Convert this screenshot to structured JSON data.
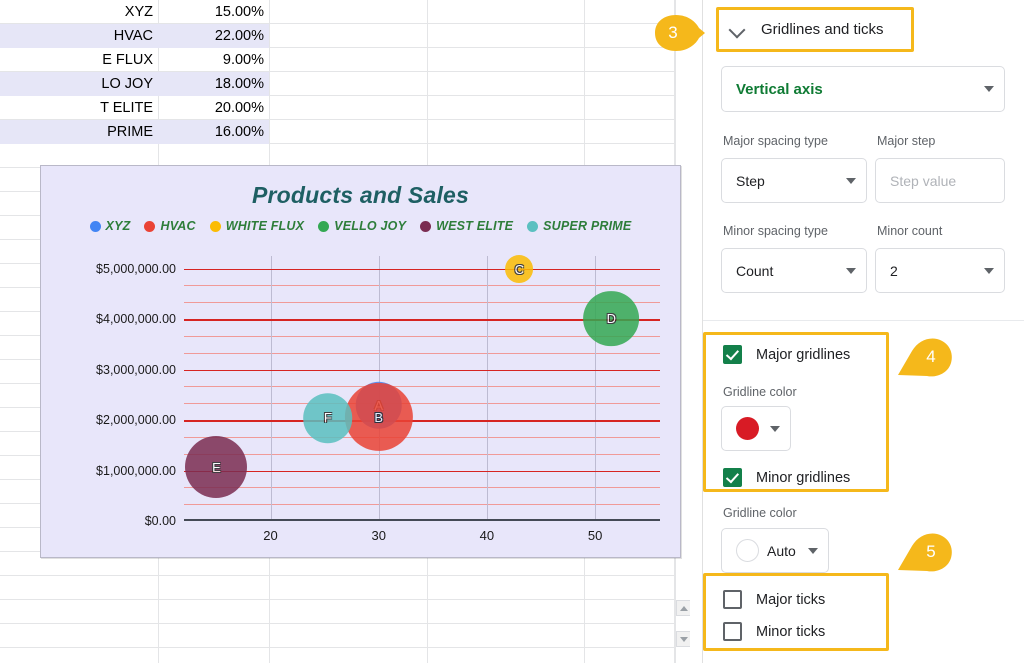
{
  "spreadsheet": {
    "rows": [
      {
        "name": "XYZ",
        "value": "15.00%",
        "shaded": false
      },
      {
        "name": "HVAC",
        "value": "22.00%",
        "shaded": true
      },
      {
        "name": "E FLUX",
        "value": "9.00%",
        "shaded": false
      },
      {
        "name": "LO JOY",
        "value": "18.00%",
        "shaded": true
      },
      {
        "name": "T ELITE",
        "value": "20.00%",
        "shaded": false
      },
      {
        "name": "PRIME",
        "value": "16.00%",
        "shaded": true
      }
    ],
    "scrollbar": {
      "up_icon": "scroll-up-arrow",
      "down_icon": "scroll-down-arrow"
    }
  },
  "chart_data": {
    "type": "scatter",
    "title": "Products and Sales",
    "xlabel": "",
    "ylabel": "",
    "xlim": [
      12,
      56
    ],
    "ylim": [
      0,
      5250000
    ],
    "xticks": [
      "20",
      "30",
      "40",
      "50"
    ],
    "xtick_values": [
      20,
      30,
      40,
      50
    ],
    "yticks": [
      "$0.00",
      "$1,000,000.00",
      "$2,000,000.00",
      "$3,000,000.00",
      "$4,000,000.00",
      "$5,000,000.00"
    ],
    "ytick_values": [
      0,
      1000000,
      2000000,
      3000000,
      4000000,
      5000000
    ],
    "grid": true,
    "major_gridline_color": "#d62422",
    "minor_gridline_color": "#f09a98",
    "minor_count": 2,
    "legend_position": "top",
    "legend": [
      "XYZ",
      "HVAC",
      "WHITE FLUX",
      "VELLO JOY",
      "WEST ELITE",
      "SUPER PRIME"
    ],
    "series_colors": [
      "#4285f4",
      "#ea4335",
      "#fbbc04",
      "#34a853",
      "#7b2d52",
      "#5bc0c0"
    ],
    "points": [
      {
        "label": "A",
        "series": "XYZ",
        "x": 30,
        "y": 2290000,
        "size": 15,
        "color": "#4285f4"
      },
      {
        "label": "B",
        "series": "HVAC",
        "x": 30,
        "y": 2060000,
        "size": 22,
        "color": "#ea4335"
      },
      {
        "label": "C",
        "series": "WHITE FLUX",
        "x": 43,
        "y": 4990000,
        "size": 9,
        "color": "#fbbc04"
      },
      {
        "label": "D",
        "series": "VELLO JOY",
        "x": 51.5,
        "y": 4010000,
        "size": 18,
        "color": "#34a853"
      },
      {
        "label": "E",
        "series": "WEST ELITE",
        "x": 15,
        "y": 1060000,
        "size": 20,
        "color": "#7b2d52"
      },
      {
        "label": "F",
        "series": "SUPER PRIME",
        "x": 25.3,
        "y": 2040000,
        "size": 16,
        "color": "#5bc0c0"
      }
    ]
  },
  "panel": {
    "header": {
      "title": "Gridlines and ticks",
      "collapse_icon": "chevron-down-icon"
    },
    "axis_select": {
      "value": "Vertical axis",
      "caret_icon": "chevron-down-icon"
    },
    "major_spacing": {
      "label": "Major spacing type",
      "value": "Step",
      "caret_icon": "chevron-down-icon"
    },
    "major_step": {
      "label": "Major step",
      "placeholder": "Step value",
      "value": ""
    },
    "minor_spacing": {
      "label": "Minor spacing type",
      "value": "Count",
      "caret_icon": "chevron-down-icon"
    },
    "minor_count": {
      "label": "Minor count",
      "value": "2",
      "caret_icon": "chevron-down-icon"
    },
    "major_gridlines": {
      "label": "Major gridlines",
      "checked": true
    },
    "major_gridline_color": {
      "label": "Gridline color",
      "color": "#d81b25",
      "caret_icon": "chevron-down-icon"
    },
    "minor_gridlines": {
      "label": "Minor gridlines",
      "checked": true
    },
    "minor_gridline_color": {
      "label": "Gridline color",
      "value": "Auto",
      "color": "#ffffff",
      "caret_icon": "chevron-down-icon"
    },
    "major_ticks": {
      "label": "Major ticks",
      "checked": false
    },
    "minor_ticks": {
      "label": "Minor ticks",
      "checked": false
    }
  },
  "callouts": [
    {
      "number": "3",
      "direction": "right"
    },
    {
      "number": "4",
      "direction": "left"
    },
    {
      "number": "5",
      "direction": "left"
    }
  ],
  "accent_color": "#f5b81b"
}
